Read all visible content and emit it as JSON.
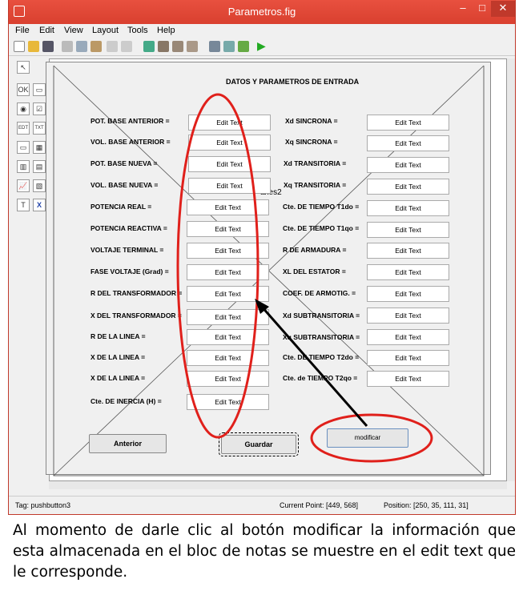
{
  "window": {
    "title": "Parametros.fig",
    "min": "–",
    "max": "□",
    "close": "✕"
  },
  "menu": [
    "File",
    "Edit",
    "View",
    "Layout",
    "Tools",
    "Help"
  ],
  "palette_items": [
    "↖",
    "OK",
    "▭",
    "◉",
    "☑",
    "EDT",
    "TXT",
    "▭",
    "▦",
    "▥",
    "▤",
    "📈",
    "▧",
    "T",
    "X"
  ],
  "form": {
    "heading": "DATOS Y PARAMETROS DE ENTRADA",
    "axes_label": "axes2",
    "left_labels": [
      "POT. BASE ANTERIOR =",
      "VOL. BASE ANTERIOR =",
      "POT. BASE NUEVA =",
      "VOL. BASE NUEVA =",
      "POTENCIA REAL =",
      "POTENCIA REACTIVA =",
      "VOLTAJE TERMINAL =",
      "FASE VOLTAJE (Grad) =",
      "R DEL TRANSFORMADOR =",
      "X DEL TRANSFORMADOR =",
      "R DE LA LINEA =",
      "X DE LA LINEA =",
      "X DE LA LINEA =",
      "Cte. DE INERCIA (H) ="
    ],
    "right_labels": [
      "Xd SINCRONA =",
      "Xq SINCRONA =",
      "Xd TRANSITORIA =",
      "Xq TRANSITORIA =",
      "Cte. DE TIEMPO T1do =",
      "Cte. DE TIEMPO T1qo =",
      "R DE ARMADURA =",
      "XL DEL ESTATOR =",
      "COEF. DE ARMOTIG. =",
      "Xd SUBTRANSITORIA =",
      "Xq SUBTRANSITORIA =",
      "Cte. DE TIEMPO T2do =",
      "Cte. de TIEMPO T2qo ="
    ],
    "edit_text": "Edit Text",
    "buttons": {
      "anterior": "Anterior",
      "guardar": "Guardar",
      "modificar": "modificar"
    }
  },
  "status": {
    "tag": "Tag: pushbutton3",
    "current_point": "Current Point:  [449, 568]",
    "position": "Position: [250, 35, 111, 31]"
  },
  "caption": "Al momento de darle clic al botón modificar la información que esta almacenada en el bloc de notas se muestre en el edit text que le corresponde.",
  "colors": {
    "titlebar": "#e74c3c",
    "annotation": "#e0201b"
  }
}
